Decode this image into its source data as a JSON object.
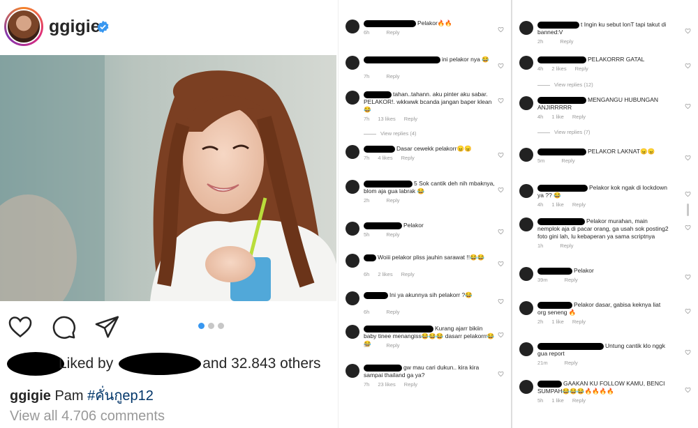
{
  "post": {
    "username": "ggigie",
    "liked_by_prefix": "Liked by",
    "liked_by_suffix": "and 32.843 others",
    "caption_username": "ggigie",
    "caption_text": "Pam",
    "caption_hashtag": "#คั่นกูep12",
    "view_all_comments": "View all 4.706 comments",
    "carousel_dots": 3,
    "carousel_active": 0
  },
  "icons": {
    "verified": "verified-badge-icon",
    "like": "heart-icon",
    "comment": "comment-bubble-icon",
    "share": "paper-plane-icon",
    "comment_like": "small-heart-icon"
  },
  "colors": {
    "verified_blue": "#3897f0",
    "active_dot": "#3897f0",
    "muted_text": "#999999",
    "hashtag": "#003569"
  },
  "comments_left": [
    {
      "text": "Pelakor🔥🔥",
      "time": "6h",
      "likes": "",
      "reply": "Reply"
    },
    {
      "text": "ini pelakor nya 😂",
      "time": "7h",
      "likes": "",
      "reply": "Reply"
    },
    {
      "text": "tahan..tahann. aku pinter aku sabar. PELAKOR!. wkkwwk bcanda jangan baper klean😂",
      "time": "7h",
      "likes": "13 likes",
      "reply": "Reply",
      "view_replies": "View replies (4)"
    },
    {
      "text": "Dasar cewekk pelakorr😠😠",
      "time": "7h",
      "likes": "4 likes",
      "reply": "Reply"
    },
    {
      "text": "5 Sok cantik deh nih mbaknya, blom aja gua labrak 😂",
      "time": "2h",
      "likes": "",
      "reply": "Reply"
    },
    {
      "text": "Pelakor",
      "time": "5h",
      "likes": "",
      "reply": "Reply"
    },
    {
      "text": "Woiii pelakor pliss jauhin sarawat !!😂😂",
      "time": "6h",
      "likes": "2 likes",
      "reply": "Reply"
    },
    {
      "text": "Ini ya akunnya sih pelakorr ?😂",
      "time": "6h",
      "likes": "",
      "reply": "Reply"
    },
    {
      "text": "Kurang ajarr bikiin baby tinee menangiss😂😂😂 dasarr pelakorrr😂😂",
      "time": "5h",
      "likes": "",
      "reply": "Reply"
    },
    {
      "text": "gw mau cari dukun.. kira kira sampai thailand ga ya?",
      "time": "7h",
      "likes": "23 likes",
      "reply": "Reply"
    }
  ],
  "comments_right": [
    {
      "text": "t Ingin ku sebut lonT tapi takut di banned:V",
      "time": "2h",
      "likes": "",
      "reply": "Reply"
    },
    {
      "text": "PELAKORRR GATAL",
      "time": "4h",
      "likes": "2 likes",
      "reply": "Reply",
      "view_replies": "View replies (12)"
    },
    {
      "text": "MENGANGU HUBUNGAN ANJIRRRRR",
      "time": "4h",
      "likes": "1 like",
      "reply": "Reply",
      "view_replies": "View replies (7)"
    },
    {
      "text": "PELAKOR LAKNAT😠😠",
      "time": "5m",
      "likes": "",
      "reply": "Reply"
    },
    {
      "text": "Pelakor kok ngak di lockdown ya ?? 😂",
      "time": "4h",
      "likes": "1 like",
      "reply": "Reply"
    },
    {
      "text": "Pelakor murahan, main nemplok aja di pacar orang, ga usah sok posting2 foto gini lah, lu kebaperan ya sama scriptnya",
      "time": "1h",
      "likes": "",
      "reply": "Reply"
    },
    {
      "text": "Pelakor",
      "time": "39m",
      "likes": "",
      "reply": "Reply"
    },
    {
      "text": "Pelakor dasar, gabisa keknya liat org seneng 🔥",
      "time": "2h",
      "likes": "1 like",
      "reply": "Reply"
    },
    {
      "text": "Untung cantik klo nggk gua report",
      "time": "21m",
      "likes": "",
      "reply": "Reply"
    },
    {
      "text": "GAAKAN KU FOLLOW KAMU, BENCI SUMPAH😂😂😂🔥🔥🔥🔥",
      "time": "5h",
      "likes": "1 like",
      "reply": "Reply"
    }
  ]
}
